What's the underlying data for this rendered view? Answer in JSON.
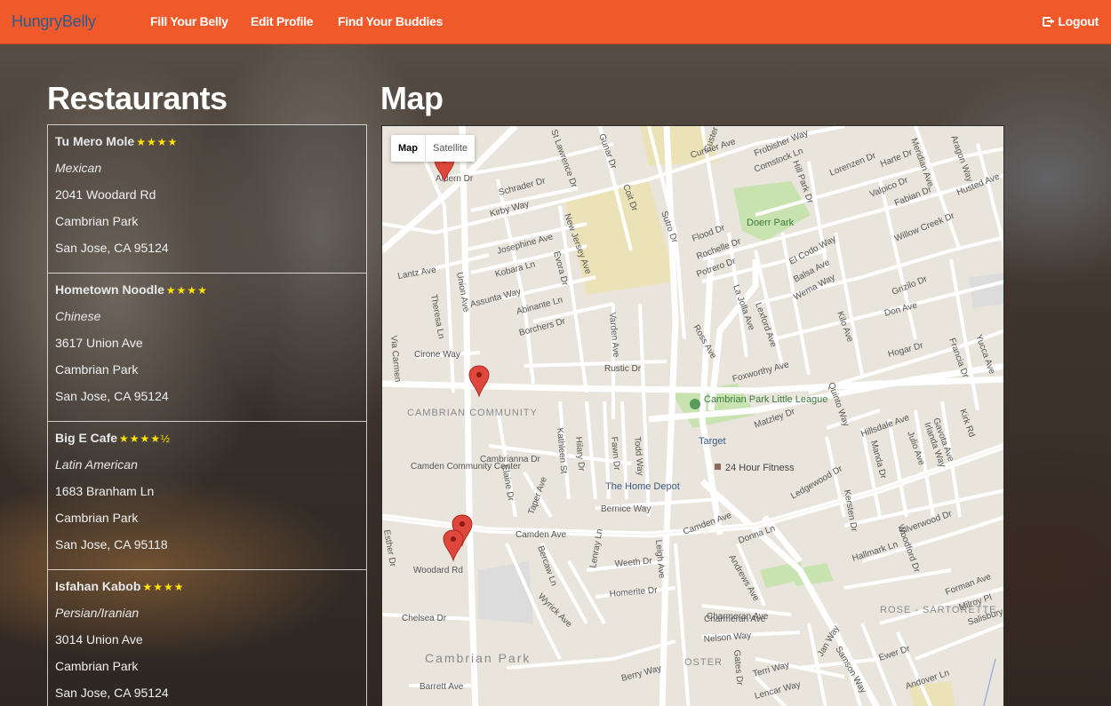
{
  "navbar": {
    "brand": "HungryBelly",
    "links": [
      "Fill Your Belly",
      "Edit Profile",
      "Find Your Buddies"
    ],
    "logout": "Logout"
  },
  "headings": {
    "restaurants": "Restaurants",
    "map": "Map"
  },
  "restaurants": [
    {
      "name": "Tu Mero Mole",
      "stars": "★★★★",
      "cuisine": "Mexican",
      "street": "2041 Woodard Rd",
      "area": "Cambrian Park",
      "city": "San Jose, CA 95124"
    },
    {
      "name": "Hometown Noodle",
      "stars": "★★★★",
      "cuisine": "Chinese",
      "street": "3617 Union Ave",
      "area": "Cambrian Park",
      "city": "San Jose, CA 95124"
    },
    {
      "name": "Big E Cafe",
      "stars": "★★★★½",
      "cuisine": "Latin American",
      "street": "1683 Branham Ln",
      "area": "Cambrian Park",
      "city": "San Jose, CA 95118"
    },
    {
      "name": "Isfahan Kabob",
      "stars": "★★★★",
      "cuisine": "Persian/Iranian",
      "street": "3014 Union Ave",
      "area": "Cambrian Park",
      "city": "San Jose, CA 95124"
    }
  ],
  "map": {
    "type_control": {
      "map": "Map",
      "satellite": "Satellite"
    },
    "streets": [
      "Curtner Ave",
      "Frobisher Way",
      "Comstock Ln",
      "Lorenzen Dr",
      "Harte Dr",
      "Meridian Ave",
      "Aragon Way",
      "Husted Ave",
      "Schrader Dr",
      "Kirby Way",
      "Josephine Ave",
      "Kobara Ln",
      "Assunta Way",
      "Abinante Ln",
      "Borchers Dr",
      "Lantz Ave",
      "Theresa Ln",
      "Via Carmen",
      "Cirone Way",
      "Union Ave",
      "New Jersey Ave",
      "Evora Dr",
      "Varden Ave",
      "Rustic Dr",
      "Flood Dr",
      "Rochelle Dr",
      "Potrero Dr",
      "El Codo Way",
      "Balsa Ave",
      "Wema Way",
      "Willow Creek Dr",
      "Grizilo Dr",
      "Don Ave",
      "Foxworthy Ave",
      "Hogar Dr",
      "Francia Dr",
      "Yucca Ave",
      "Ross Ave",
      "Quinto Way",
      "Matzley Dr",
      "Hillsdale Ave",
      "Kirk Rd",
      "Gavota Ave",
      "Kathleen St",
      "Hilary Dr",
      "Fawn Dr",
      "Todd Way",
      "Cambrianna Dr",
      "Elaine Dr",
      "Bernice Way",
      "Camden Ave",
      "Esther Dr",
      "Woodard Rd",
      "Taper Ave",
      "Bercaw Ln",
      "Weeth Dr",
      "Lenray Ln",
      "Homerite Dr",
      "Wyrick Ave",
      "Donna Ln",
      "Andrews Ave",
      "Hallmark Ln",
      "Silverwood Dr",
      "Woodford Dr",
      "Forman Ave",
      "Milroy Pl",
      "Salisbury",
      "Chelsea Dr",
      "Charmeran Ave",
      "Nelson Way",
      "Berry Way",
      "Gates Dr",
      "Terri Way",
      "Lencar Way",
      "Jan Way",
      "Samson Way",
      "Ewer Dr",
      "Andover Ln",
      "Barrett Ave",
      "Leigh Ave",
      "St Lawrence Dr",
      "Gunar Dr",
      "Coit Dr",
      "Sutro Dr",
      "Custer Dr",
      "Hill Park Dr",
      "Valpico Dr",
      "Fabian Dr",
      "La Jolla Ave",
      "Lexford Ave",
      "Kilo Ave",
      "Ledgewood Dr",
      "Kersten Dr",
      "Manda Dr",
      "Julio Ave",
      "Irlanda Way",
      "Camden Ave",
      "Charmeran Ave",
      "Aldern Dr"
    ],
    "areas": [
      "CAMBRIAN COMMUNITY",
      "Cambrian Park",
      "ROSE - SARTORETTE",
      "OSTER"
    ],
    "pois": [
      "Doerr Park",
      "Cambrian Park Little League",
      "Target",
      "24 Hour Fitness",
      "The Home Depot",
      "Camden Community Center"
    ],
    "colors": {
      "land": "#e9e5dc",
      "road": "#ffffff",
      "park": "#c8e2b0",
      "campus": "#ece2b8",
      "marker": "#e0473c"
    }
  },
  "colors": {
    "navbar": "#f0592a",
    "brand": "#2a5d8f",
    "stars": "#ffe400"
  }
}
